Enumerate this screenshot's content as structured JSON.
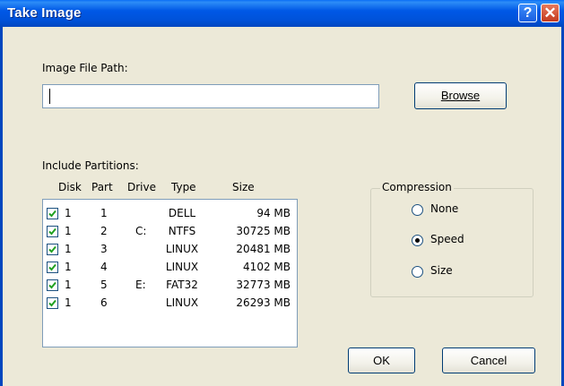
{
  "window": {
    "title": "Take Image",
    "help_label": "?",
    "close_label": "✕"
  },
  "image_path": {
    "label": "Image File Path:",
    "value": "",
    "browse_label": "Browse"
  },
  "partitions": {
    "label": "Include Partitions:",
    "headers": {
      "disk": "Disk",
      "part": "Part",
      "drive": "Drive",
      "type": "Type",
      "size": "Size"
    },
    "rows": [
      {
        "checked": true,
        "disk": "1",
        "part": "1",
        "drive": "",
        "type": "DELL",
        "size": "94 MB"
      },
      {
        "checked": true,
        "disk": "1",
        "part": "2",
        "drive": "C:",
        "type": "NTFS",
        "size": "30725 MB"
      },
      {
        "checked": true,
        "disk": "1",
        "part": "3",
        "drive": "",
        "type": "LINUX",
        "size": "20481 MB"
      },
      {
        "checked": true,
        "disk": "1",
        "part": "4",
        "drive": "",
        "type": "LINUX",
        "size": "4102 MB"
      },
      {
        "checked": true,
        "disk": "1",
        "part": "5",
        "drive": "E:",
        "type": "FAT32",
        "size": "32773 MB"
      },
      {
        "checked": true,
        "disk": "1",
        "part": "6",
        "drive": "",
        "type": "LINUX",
        "size": "26293 MB"
      }
    ]
  },
  "compression": {
    "label": "Compression",
    "options": [
      {
        "label": "None",
        "selected": false
      },
      {
        "label": "Speed",
        "selected": true
      },
      {
        "label": "Size",
        "selected": false
      }
    ]
  },
  "buttons": {
    "ok_label": "OK",
    "cancel_label": "Cancel"
  }
}
